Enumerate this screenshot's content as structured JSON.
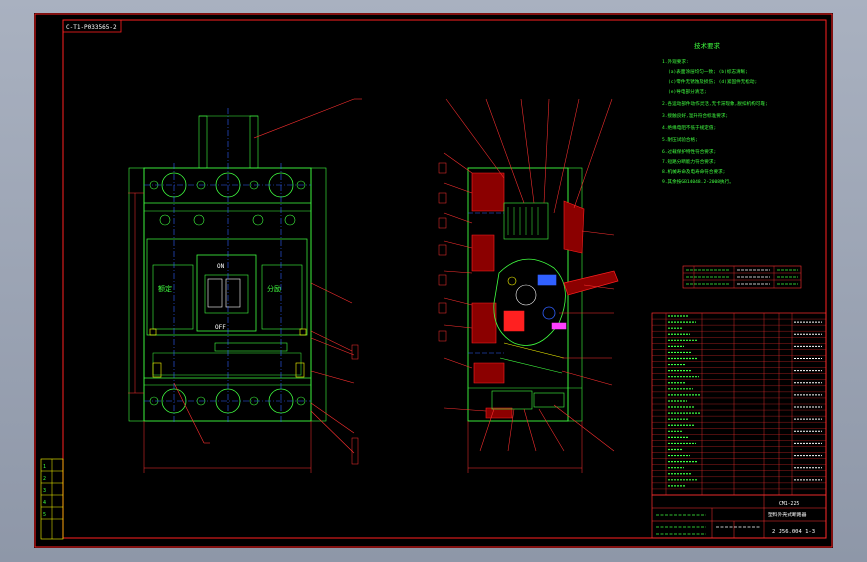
{
  "title_tag": "C-T1-P033565-2",
  "tech_requirements": {
    "heading": "技术要求",
    "lines": [
      "1.外观要求:",
      "(a)表面涂层均匀一致;  (b)标志清晰;",
      "(c)零件无锈蚀及损伤;  (d)紧固件无松动;",
      "(e)导电部分清洁;",
      "2.各运动部件动作灵活,无卡滞现象,脱扣机构可靠;",
      "3.接触良好,温升符合标准要求;",
      "4.绝缘电阻不低于规定值;",
      "5.耐压试验合格;",
      "6.过载保护特性符合要求;",
      "7.短路分断能力符合要求;",
      "8.机械寿命及电寿命符合要求;",
      "9.其余按GB14048.2-2008执行。"
    ]
  },
  "front_view": {
    "on_label": "ON",
    "off_label": "OFF",
    "left_label": "额定",
    "right_label": "分励"
  },
  "side_table": [
    "1",
    "2",
    "3",
    "4",
    "5"
  ],
  "title_block": {
    "drawing_name": "塑料外壳式断路器",
    "drawing_number": "2 J56.004 1-3",
    "model": "CM1-225"
  }
}
